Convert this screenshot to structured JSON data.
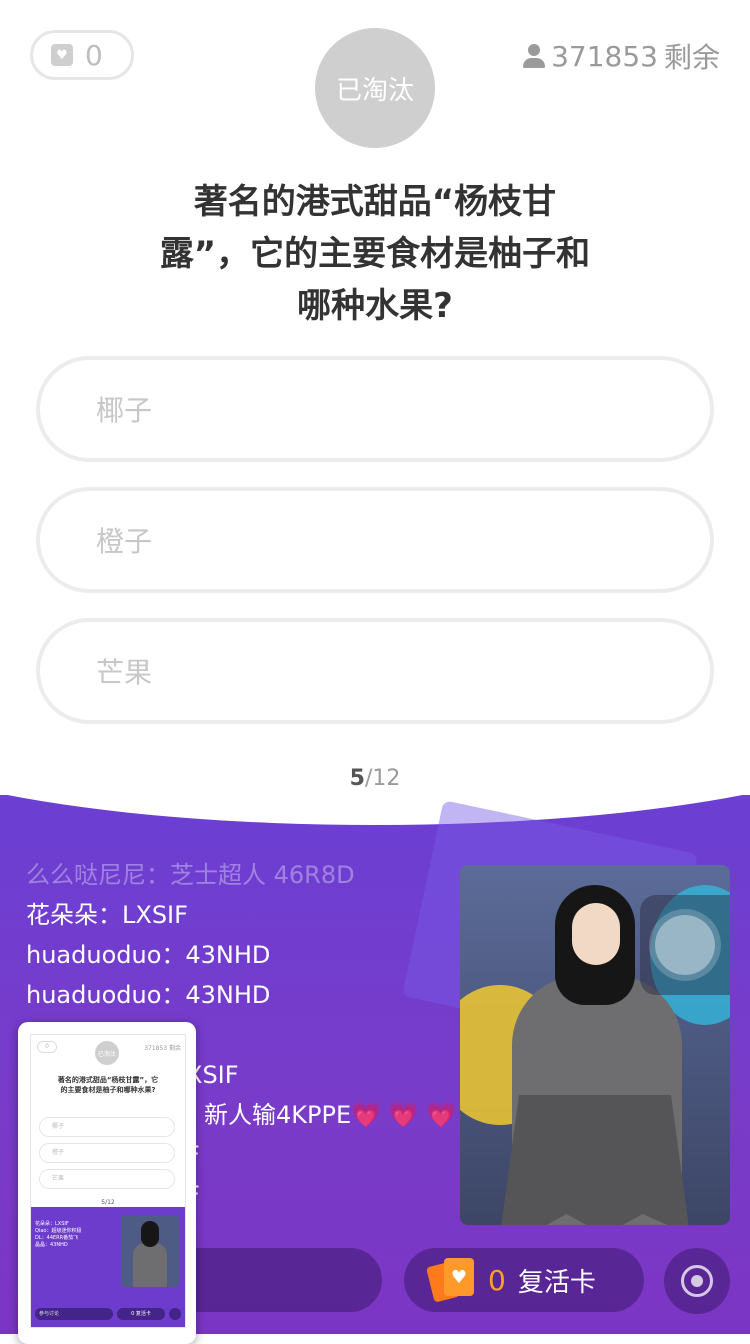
{
  "header": {
    "lives_count": "0",
    "status_circle": "已淘汰",
    "remaining_count": "371853",
    "remaining_label": "剩余"
  },
  "question": {
    "line1": "著名的港式甜品“杨枝甘",
    "line2": "露”，它的主要食材是柚子和",
    "line3": "哪种水果?"
  },
  "options": [
    {
      "label": "椰子"
    },
    {
      "label": "橙子"
    },
    {
      "label": "芒果"
    }
  ],
  "progress": {
    "current": "5",
    "total": "/12"
  },
  "chat": [
    {
      "user": "么么哒尼尼",
      "sep": "：",
      "msg": "芝士超人 46R8D"
    },
    {
      "user": "花朵朵",
      "sep": "：",
      "msg": "LXSIF"
    },
    {
      "user": "huaduoduo",
      "sep": "：",
      "msg": "43NHD"
    },
    {
      "user": "huaduoduo",
      "sep": "：",
      "msg": "43NHD"
    },
    {
      "user": "",
      "sep": "",
      "msg": ""
    },
    {
      "user": "",
      "sep": "",
      "msg": "XSIF"
    },
    {
      "user": "",
      "sep": "",
      "msg": "新人输4KPPE💗 💗 💗"
    },
    {
      "user": "",
      "sep": "",
      "msg": "F"
    },
    {
      "user": "",
      "sep": "",
      "msg": "F"
    }
  ],
  "revive": {
    "count": "0",
    "label": "复活卡"
  },
  "colors": {
    "accent_purple": "#6b3fd3",
    "revive_orange": "#ffa024",
    "muted_gray": "#cfcfcf"
  },
  "icons": {
    "lives": "heart-icon",
    "users": "user-icon",
    "revive_card": "card-heart-icon",
    "record": "record-icon"
  },
  "thumbnail": {
    "lives": "0",
    "circle": "已淘汰",
    "remaining": "371853 剩余",
    "question": "著名的港式甜品“杨枝甘露”，它的主要食材是柚子和哪种水果?",
    "options": [
      "椰子",
      "橙子",
      "芒果"
    ],
    "progress": "5/12",
    "chat": [
      "花朵朵：LXSIF",
      "Qiao：超级迷你积极",
      "DL：44ERR番茄飞",
      "晶晶：43NHD"
    ],
    "comment": "参与讨论",
    "revive": "0 复活卡"
  }
}
